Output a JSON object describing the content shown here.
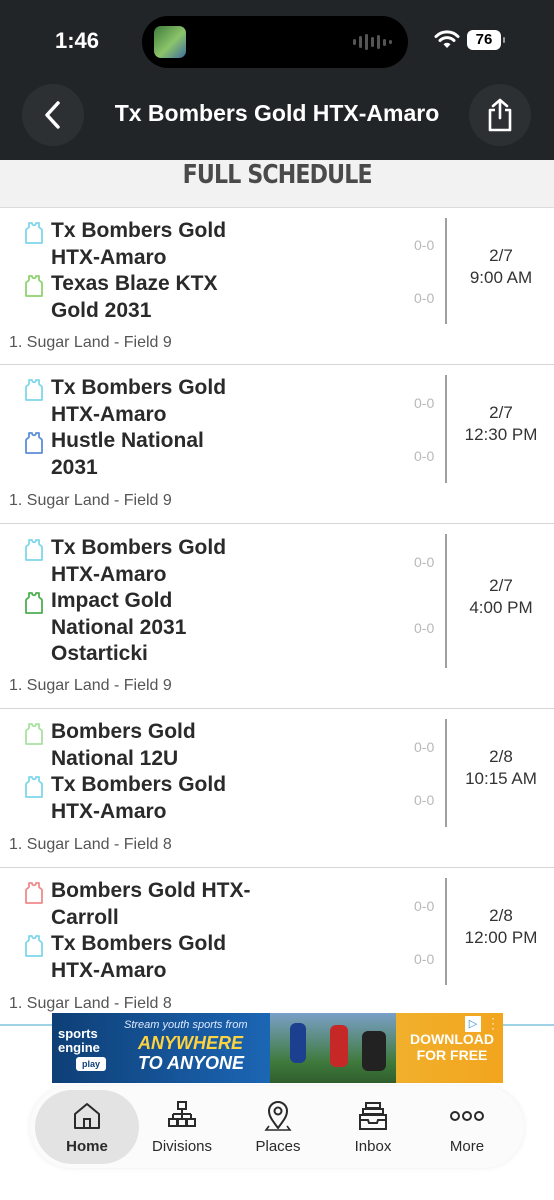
{
  "status_bar": {
    "time": "1:46",
    "battery": "76"
  },
  "header": {
    "title": "Tx Bombers Gold HTX-Amaro"
  },
  "section_title": "FULL SCHEDULE",
  "games": [
    {
      "team1": "Tx Bombers Gold HTX-Amaro",
      "team1_color": "#7fd6ec",
      "score1": "0-0",
      "team2": "Texas Blaze KTX Gold 2031",
      "team2_color": "#8ed36f",
      "score2": "0-0",
      "date": "2/7",
      "time": "9:00 AM",
      "location": "1. Sugar Land - Field 9"
    },
    {
      "team1": "Tx Bombers Gold HTX-Amaro",
      "team1_color": "#7fd6ec",
      "score1": "0-0",
      "team2": "Hustle National 2031",
      "team2_color": "#5c8fd6",
      "score2": "0-0",
      "date": "2/7",
      "time": "12:30 PM",
      "location": "1. Sugar Land - Field 9"
    },
    {
      "team1": "Tx Bombers Gold HTX-Amaro",
      "team1_color": "#7fd6ec",
      "score1": "0-0",
      "team2": "Impact Gold National 2031 Ostarticki",
      "team2_color": "#4caf50",
      "score2": "0-0",
      "date": "2/7",
      "time": "4:00 PM",
      "location": "1. Sugar Land - Field 9"
    },
    {
      "team1": "Bombers Gold National 12U",
      "team1_color": "#a8e2a0",
      "score1": "0-0",
      "team2": "Tx Bombers Gold HTX-Amaro",
      "team2_color": "#7fd6ec",
      "score2": "0-0",
      "date": "2/8",
      "time": "10:15 AM",
      "location": "1. Sugar Land - Field 8"
    },
    {
      "team1": "Bombers Gold HTX- Carroll",
      "team1_color": "#f08a8a",
      "score1": "0-0",
      "team2": "Tx Bombers Gold HTX-Amaro",
      "team2_color": "#7fd6ec",
      "score2": "0-0",
      "date": "2/8",
      "time": "12:00 PM",
      "location": "1. Sugar Land - Field 8"
    }
  ],
  "ad": {
    "brand": "sports engine",
    "brand_sub": "play",
    "tagline": "Stream youth sports from",
    "headline_1": "ANYWHERE",
    "headline_2": "TO ANYONE",
    "cta": "DOWNLOAD FOR FREE"
  },
  "tabs": [
    {
      "label": "Home",
      "icon": "home-icon"
    },
    {
      "label": "Divisions",
      "icon": "bracket-icon"
    },
    {
      "label": "Places",
      "icon": "location-pin-icon"
    },
    {
      "label": "Inbox",
      "icon": "inbox-icon"
    },
    {
      "label": "More",
      "icon": "more-dots-icon"
    }
  ]
}
